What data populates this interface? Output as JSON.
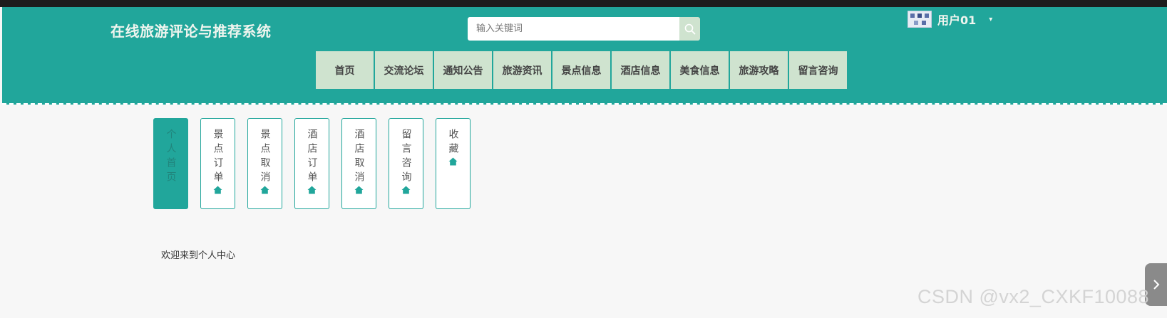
{
  "header": {
    "site_title": "在线旅游评论与推荐系统",
    "search_placeholder": "输入关键词",
    "username": "用户01",
    "caret": "▾"
  },
  "nav": {
    "items": [
      "首页",
      "交流论坛",
      "通知公告",
      "旅游资讯",
      "景点信息",
      "酒店信息",
      "美食信息",
      "旅游攻略",
      "留言咨询"
    ]
  },
  "side_tabs": {
    "items": [
      "个人首页",
      "景点订单",
      "景点取消",
      "酒店订单",
      "酒店取消",
      "留言咨询",
      "收藏"
    ],
    "active_index": 0
  },
  "main": {
    "welcome": "欢迎来到个人中心"
  },
  "watermark": "CSDN @vx2_CXKF10088",
  "colors": {
    "header_bg": "#21a69b",
    "nav_bg": "#cfe3cf",
    "accent": "#21a69b"
  },
  "icons": {
    "search": "search-icon",
    "tab": "home-icon",
    "side_arrow": "chevron-right-icon"
  }
}
